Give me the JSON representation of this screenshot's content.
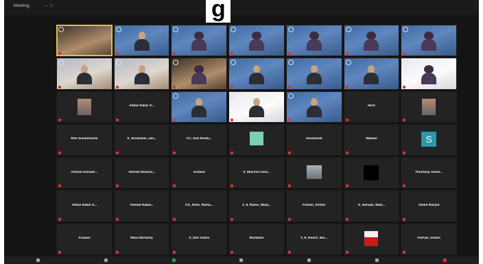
{
  "window": {
    "title": "Meeting"
  },
  "headline": "g",
  "tiles": [
    {
      "kind": "video",
      "style": "warm",
      "person": "none",
      "label": "",
      "active": true
    },
    {
      "kind": "video",
      "style": "blue",
      "person": "man",
      "label": ""
    },
    {
      "kind": "video",
      "style": "blue",
      "person": "hijab",
      "label": ""
    },
    {
      "kind": "video",
      "style": "blue",
      "person": "hijab",
      "label": ""
    },
    {
      "kind": "video",
      "style": "blue",
      "person": "hijab",
      "label": ""
    },
    {
      "kind": "video",
      "style": "blue",
      "person": "hijab",
      "label": ""
    },
    {
      "kind": "video",
      "style": "blue",
      "person": "hijab",
      "label": ""
    },
    {
      "kind": "video",
      "style": "light",
      "person": "man",
      "label": ""
    },
    {
      "kind": "video",
      "style": "light",
      "person": "man",
      "label": ""
    },
    {
      "kind": "video",
      "style": "warm",
      "person": "hijab",
      "label": ""
    },
    {
      "kind": "video",
      "style": "blue",
      "person": "man",
      "label": ""
    },
    {
      "kind": "video",
      "style": "blue",
      "person": "man",
      "label": ""
    },
    {
      "kind": "video",
      "style": "blue",
      "person": "man",
      "label": ""
    },
    {
      "kind": "video",
      "style": "white",
      "person": "hijab",
      "label": ""
    },
    {
      "kind": "thumb",
      "thumb": "portrait",
      "name": "",
      "label": ""
    },
    {
      "kind": "name",
      "name": "Abdul Sabar S...",
      "label": ""
    },
    {
      "kind": "video",
      "style": "blue",
      "person": "man",
      "label": ""
    },
    {
      "kind": "video",
      "style": "white",
      "person": "man",
      "label": ""
    },
    {
      "kind": "video",
      "style": "blue",
      "person": "man",
      "label": ""
    },
    {
      "kind": "name",
      "name": "Host",
      "label": ""
    },
    {
      "kind": "thumb",
      "thumb": "portrait",
      "name": "",
      "label": ""
    },
    {
      "kind": "name",
      "name": "Rita Susilohosmi",
      "label": ""
    },
    {
      "kind": "name",
      "name": "S_Susilohat...um...",
      "label": ""
    },
    {
      "kind": "name",
      "name": "CC_Suli Rumb...",
      "label": ""
    },
    {
      "kind": "thumb",
      "thumb": "square",
      "name": "",
      "label": ""
    },
    {
      "kind": "name",
      "name": "Alvialuhah",
      "label": ""
    },
    {
      "kind": "name",
      "name": "Wawan",
      "label": ""
    },
    {
      "kind": "thumb",
      "thumb": "avatar",
      "name": "S",
      "label": ""
    },
    {
      "kind": "name",
      "name": "Ahmad Zunaim...",
      "label": ""
    },
    {
      "kind": "name",
      "name": "Ahmad Hazarul...",
      "label": ""
    },
    {
      "kind": "name",
      "name": "Acitaan",
      "label": ""
    },
    {
      "kind": "name",
      "name": "S_Muchsil Auta...",
      "label": ""
    },
    {
      "kind": "thumb",
      "thumb": "smallvid",
      "name": "",
      "label": ""
    },
    {
      "kind": "thumb",
      "thumb": "black",
      "name": "",
      "label": ""
    },
    {
      "kind": "name",
      "name": "Thursday Anam...",
      "label": ""
    },
    {
      "kind": "name",
      "name": "Abdul Sabar S...",
      "label": ""
    },
    {
      "kind": "name",
      "name": "Ahmad Habal...",
      "label": ""
    },
    {
      "kind": "name",
      "name": "CG_Dewi_Rama...",
      "label": ""
    },
    {
      "kind": "name",
      "name": "2_8_Rama_Widy...",
      "label": ""
    },
    {
      "kind": "name",
      "name": "Farhan_Irmtan",
      "label": ""
    },
    {
      "kind": "name",
      "name": "S_Haruda_Wad...",
      "label": ""
    },
    {
      "kind": "name",
      "name": "Abdul Rasyid",
      "label": ""
    },
    {
      "kind": "name",
      "name": "Acitaan",
      "label": ""
    },
    {
      "kind": "name",
      "name": "Reza Norbarty",
      "label": ""
    },
    {
      "kind": "name",
      "name": "S_Dwi Yulani",
      "label": ""
    },
    {
      "kind": "name",
      "name": "Rustanto",
      "label": ""
    },
    {
      "kind": "name",
      "name": "2_8_Hirarti_Wu...",
      "label": ""
    },
    {
      "kind": "thumb",
      "thumb": "redpic",
      "name": "",
      "label": ""
    },
    {
      "kind": "name",
      "name": "Farhan_Irmtan",
      "label": ""
    }
  ]
}
